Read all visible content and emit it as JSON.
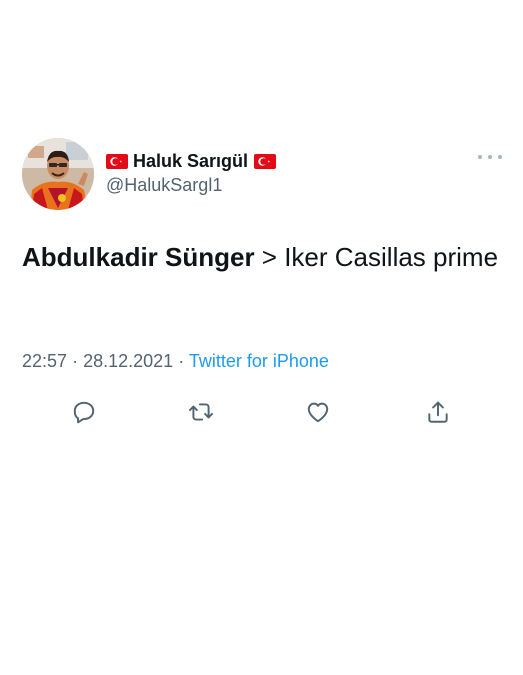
{
  "author": {
    "display_name": "Haluk Sarıgül",
    "handle": "@HalukSargl1",
    "flag_icon": "turkey-flag",
    "flag_color": "#e30a17"
  },
  "tweet": {
    "text_bold": "Abdulkadir Sünger",
    "text_rest": " > Iker Casillas prime"
  },
  "meta": {
    "time": "22:57",
    "separator": "·",
    "date": "28.12.2021",
    "source": "Twitter for iPhone"
  },
  "actions": [
    {
      "name": "reply",
      "icon": "reply-icon"
    },
    {
      "name": "retweet",
      "icon": "retweet-icon"
    },
    {
      "name": "like",
      "icon": "heart-icon"
    },
    {
      "name": "share",
      "icon": "share-icon"
    }
  ],
  "colors": {
    "link": "#1d9bf0",
    "secondary_text": "#536471",
    "icon": "#536471"
  }
}
